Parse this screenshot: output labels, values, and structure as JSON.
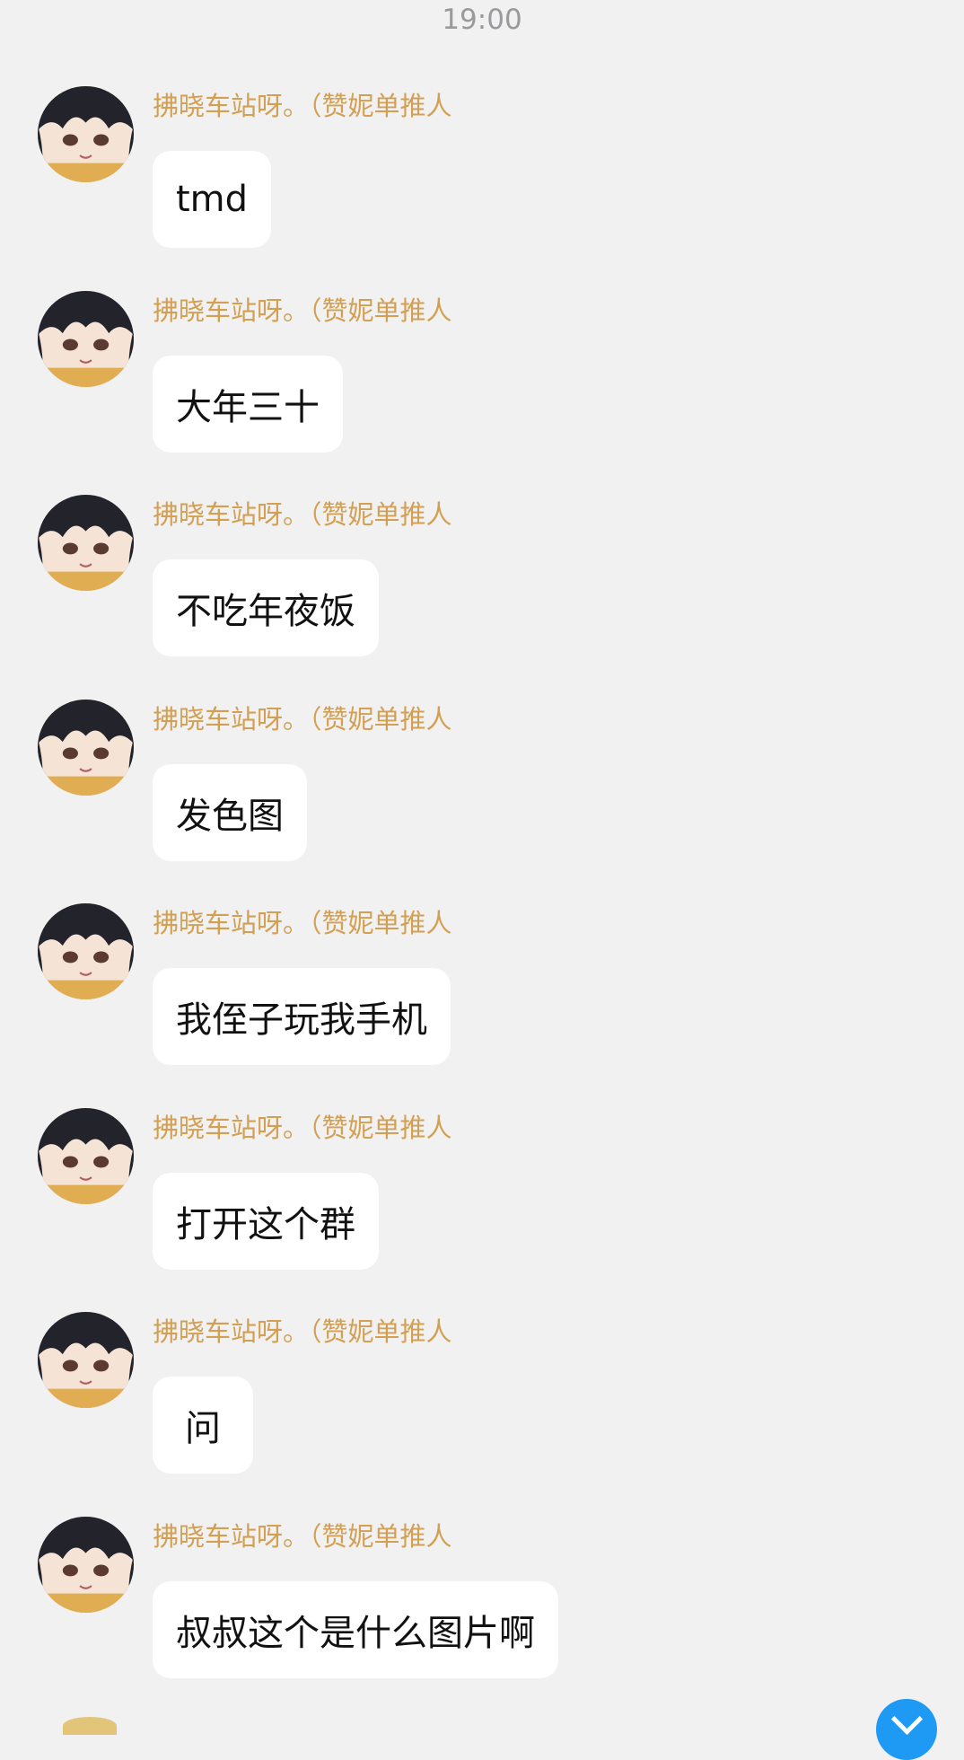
{
  "chat": {
    "timestamp": "19:00",
    "messages": [
      {
        "sender": "拂晓车站呀。（赞妮单推人",
        "text": "tmd"
      },
      {
        "sender": "拂晓车站呀。（赞妮单推人",
        "text": "大年三十"
      },
      {
        "sender": "拂晓车站呀。（赞妮单推人",
        "text": "不吃年夜饭"
      },
      {
        "sender": "拂晓车站呀。（赞妮单推人",
        "text": "发色图"
      },
      {
        "sender": "拂晓车站呀。（赞妮单推人",
        "text": "我侄子玩我手机"
      },
      {
        "sender": "拂晓车站呀。（赞妮单推人",
        "text": "打开这个群"
      },
      {
        "sender": "拂晓车站呀。（赞妮单推人",
        "text": "问"
      },
      {
        "sender": "拂晓车站呀。（赞妮单推人",
        "text": "叔叔这个是什么图片啊"
      }
    ]
  },
  "icons": {
    "avatar": "anime-girl-avatar",
    "unread_badge": "chevron-down-icon"
  },
  "colors": {
    "background": "#f1f1f2",
    "sender_name": "#d3a053",
    "bubble": "#ffffff",
    "badge": "#1e9af5"
  }
}
